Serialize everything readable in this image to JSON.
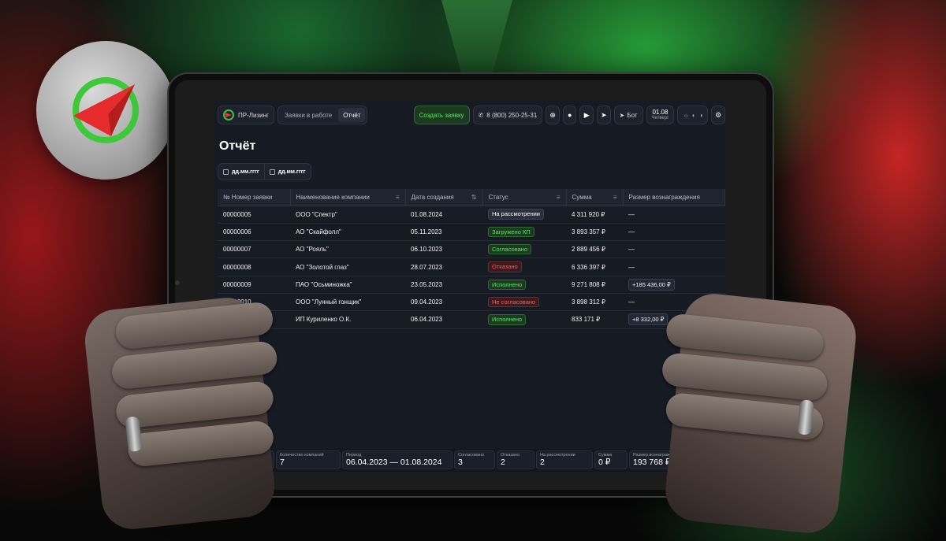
{
  "header": {
    "brand": "ПР-Лизинг",
    "tabs": [
      {
        "label": "Заявки в работе",
        "active": false
      },
      {
        "label": "Отчёт",
        "active": true
      }
    ],
    "create_button": "Создать заявку",
    "phone": "8 (800) 250-25-31",
    "bot_label": "Бот",
    "date": "01.08",
    "weekday": "Четверг"
  },
  "page": {
    "title": "Отчёт",
    "date_from_placeholder": "дд.мм.гггг",
    "date_to_placeholder": "дд.мм.гггг"
  },
  "table": {
    "columns": [
      "№ Номер заявки",
      "Наименование компании",
      "Дата создания",
      "Статус",
      "Сумма",
      "Размер вознаграждения"
    ],
    "rows": [
      {
        "id": "00000005",
        "company": "ООО \"Спектр\"",
        "date": "01.08.2024",
        "status": "На рассмотрении",
        "status_kind": "neutral",
        "sum": "4 311 920 ₽",
        "reward": "—"
      },
      {
        "id": "00000006",
        "company": "АО \"Скайфолл\"",
        "date": "05.11.2023",
        "status": "Загружено КП",
        "status_kind": "green",
        "sum": "3 893 357 ₽",
        "reward": "—"
      },
      {
        "id": "00000007",
        "company": "АО \"Рояль\"",
        "date": "06.10.2023",
        "status": "Согласовано",
        "status_kind": "green",
        "sum": "2 889 456 ₽",
        "reward": "—"
      },
      {
        "id": "00000008",
        "company": "АО \"Золотой глаз\"",
        "date": "28.07.2023",
        "status": "Отказано",
        "status_kind": "red",
        "sum": "6 336 397 ₽",
        "reward": "—"
      },
      {
        "id": "00000009",
        "company": "ПАО \"Осьминожка\"",
        "date": "23.05.2023",
        "status": "Исполнено",
        "status_kind": "green",
        "sum": "9 271 808 ₽",
        "reward": "+185 436,00 ₽"
      },
      {
        "id": "00000010",
        "company": "ООО \"Лунный гонщик\"",
        "date": "09.04.2023",
        "status": "Не согласовано",
        "status_kind": "red",
        "sum": "3 898 312 ₽",
        "reward": "—"
      },
      {
        "id": "00000011",
        "company": "ИП Куриленко О.К.",
        "date": "06.04.2023",
        "status": "Исполнено",
        "status_kind": "green",
        "sum": "833 171 ₽",
        "reward": "+8 332,00 ₽"
      }
    ]
  },
  "footer": [
    {
      "label": "Количество заявок",
      "value": "7"
    },
    {
      "label": "Количество компаний",
      "value": "7"
    },
    {
      "label": "Период",
      "value": "06.04.2023 — 01.08.2024"
    },
    {
      "label": "Согласовано",
      "value": "3"
    },
    {
      "label": "Отказано",
      "value": "2"
    },
    {
      "label": "На рассмотрении",
      "value": "2"
    },
    {
      "label": "Сумма",
      "value": "0 ₽"
    },
    {
      "label": "Размер вознаграждения",
      "value": "193 768 ₽"
    }
  ],
  "colors": {
    "accent_green": "#5ee56a",
    "status_green_bg": "#1b3a1f",
    "status_red_bg": "#3b1a1d",
    "status_red_text": "#ff5a5a",
    "screen_bg": "#161a23"
  },
  "icons": [
    "logo-icon",
    "phone-icon",
    "plus-circle-icon",
    "vk-icon",
    "youtube-icon",
    "telegram-icon",
    "sun-icon",
    "contrast-icon",
    "gear-icon",
    "calendar-icon",
    "filter-icon",
    "sort-icon"
  ]
}
